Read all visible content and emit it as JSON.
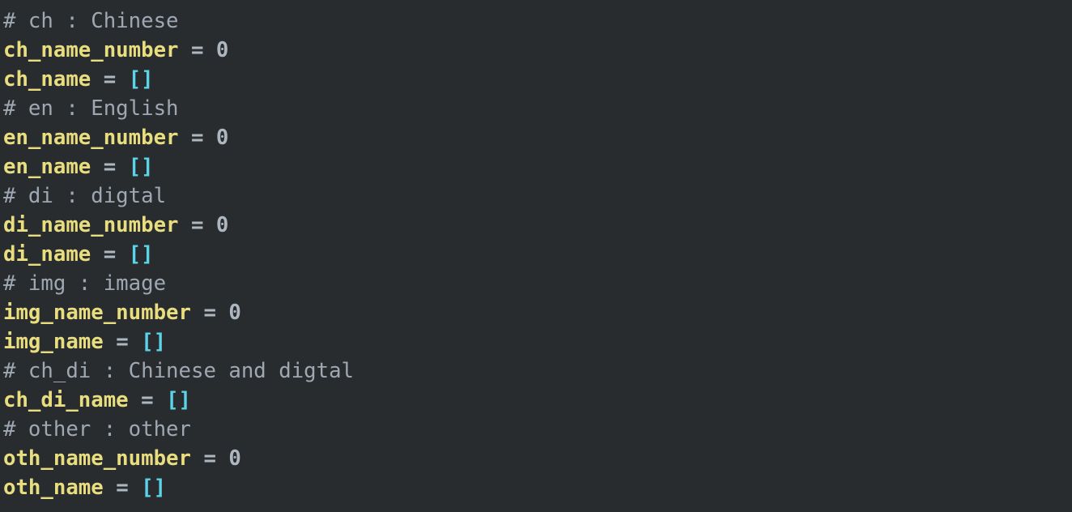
{
  "editor": {
    "language": "python",
    "background_color": "#282c2f",
    "colors": {
      "comment": "#9fa8b2",
      "identifier": "#e8dd7f",
      "operator": "#aeb7c0",
      "number": "#aeb7c0",
      "bracket": "#5bd4e8"
    },
    "lines": [
      {
        "index": 1,
        "text": "# ch : Chinese",
        "tokens": [
          {
            "t": "# ch : Chinese",
            "k": "comment"
          }
        ]
      },
      {
        "index": 2,
        "text": "ch_name_number = 0",
        "tokens": [
          {
            "t": "ch_name_number",
            "k": "ident"
          },
          {
            "t": " ",
            "k": "space"
          },
          {
            "t": "=",
            "k": "op"
          },
          {
            "t": " ",
            "k": "space"
          },
          {
            "t": "0",
            "k": "number"
          }
        ]
      },
      {
        "index": 3,
        "text": "ch_name = []",
        "tokens": [
          {
            "t": "ch_name",
            "k": "ident"
          },
          {
            "t": " ",
            "k": "space"
          },
          {
            "t": "=",
            "k": "op"
          },
          {
            "t": " ",
            "k": "space"
          },
          {
            "t": "[]",
            "k": "bracket"
          }
        ]
      },
      {
        "index": 4,
        "text": "# en : English",
        "tokens": [
          {
            "t": "# en : English",
            "k": "comment"
          }
        ]
      },
      {
        "index": 5,
        "text": "en_name_number = 0",
        "tokens": [
          {
            "t": "en_name_number",
            "k": "ident"
          },
          {
            "t": " ",
            "k": "space"
          },
          {
            "t": "=",
            "k": "op"
          },
          {
            "t": " ",
            "k": "space"
          },
          {
            "t": "0",
            "k": "number"
          }
        ]
      },
      {
        "index": 6,
        "text": "en_name = []",
        "tokens": [
          {
            "t": "en_name",
            "k": "ident"
          },
          {
            "t": " ",
            "k": "space"
          },
          {
            "t": "=",
            "k": "op"
          },
          {
            "t": " ",
            "k": "space"
          },
          {
            "t": "[]",
            "k": "bracket"
          }
        ]
      },
      {
        "index": 7,
        "text": "# di : digtal",
        "tokens": [
          {
            "t": "# di : digtal",
            "k": "comment"
          }
        ]
      },
      {
        "index": 8,
        "text": "di_name_number = 0",
        "tokens": [
          {
            "t": "di_name_number",
            "k": "ident"
          },
          {
            "t": " ",
            "k": "space"
          },
          {
            "t": "=",
            "k": "op"
          },
          {
            "t": " ",
            "k": "space"
          },
          {
            "t": "0",
            "k": "number"
          }
        ]
      },
      {
        "index": 9,
        "text": "di_name = []",
        "tokens": [
          {
            "t": "di_name",
            "k": "ident"
          },
          {
            "t": " ",
            "k": "space"
          },
          {
            "t": "=",
            "k": "op"
          },
          {
            "t": " ",
            "k": "space"
          },
          {
            "t": "[]",
            "k": "bracket"
          }
        ]
      },
      {
        "index": 10,
        "text": "# img : image",
        "tokens": [
          {
            "t": "# img : image",
            "k": "comment"
          }
        ]
      },
      {
        "index": 11,
        "text": "img_name_number = 0",
        "tokens": [
          {
            "t": "img_name_number",
            "k": "ident"
          },
          {
            "t": " ",
            "k": "space"
          },
          {
            "t": "=",
            "k": "op"
          },
          {
            "t": " ",
            "k": "space"
          },
          {
            "t": "0",
            "k": "number"
          }
        ]
      },
      {
        "index": 12,
        "text": "img_name = []",
        "tokens": [
          {
            "t": "img_name",
            "k": "ident"
          },
          {
            "t": " ",
            "k": "space"
          },
          {
            "t": "=",
            "k": "op"
          },
          {
            "t": " ",
            "k": "space"
          },
          {
            "t": "[]",
            "k": "bracket"
          }
        ]
      },
      {
        "index": 13,
        "text": "# ch_di : Chinese and digtal",
        "tokens": [
          {
            "t": "# ch_di : Chinese and digtal",
            "k": "comment"
          }
        ]
      },
      {
        "index": 14,
        "text": "ch_di_name = []",
        "tokens": [
          {
            "t": "ch_di_name",
            "k": "ident"
          },
          {
            "t": " ",
            "k": "space"
          },
          {
            "t": "=",
            "k": "op"
          },
          {
            "t": " ",
            "k": "space"
          },
          {
            "t": "[]",
            "k": "bracket"
          }
        ]
      },
      {
        "index": 15,
        "text": "# other : other",
        "tokens": [
          {
            "t": "# other : other",
            "k": "comment"
          }
        ]
      },
      {
        "index": 16,
        "text": "oth_name_number = 0",
        "tokens": [
          {
            "t": "oth_name_number",
            "k": "ident"
          },
          {
            "t": " ",
            "k": "space"
          },
          {
            "t": "=",
            "k": "op"
          },
          {
            "t": " ",
            "k": "space"
          },
          {
            "t": "0",
            "k": "number"
          }
        ]
      },
      {
        "index": 17,
        "text": "oth_name = []",
        "tokens": [
          {
            "t": "oth_name",
            "k": "ident"
          },
          {
            "t": " ",
            "k": "space"
          },
          {
            "t": "=",
            "k": "op"
          },
          {
            "t": " ",
            "k": "space"
          },
          {
            "t": "[]",
            "k": "bracket"
          }
        ]
      }
    ]
  }
}
